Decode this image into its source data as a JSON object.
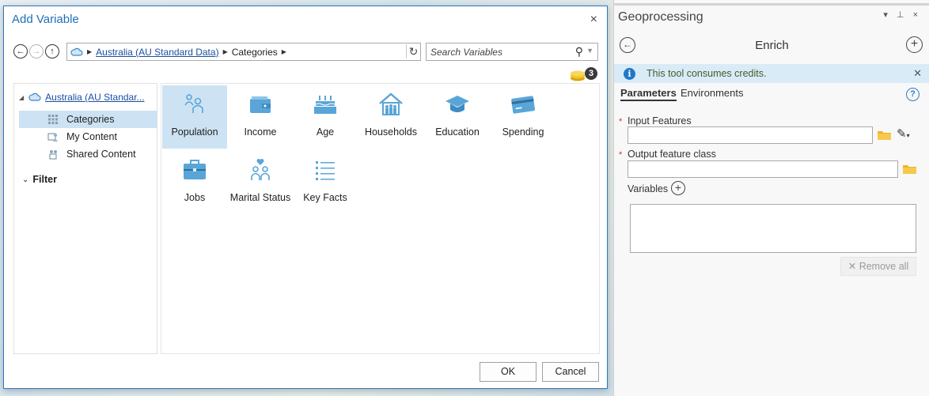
{
  "dialog": {
    "title": "Add Variable",
    "close": "×",
    "path": {
      "root_link": "Australia (AU Standard Data)",
      "segment": "Categories"
    },
    "search": {
      "placeholder": "Search Variables"
    },
    "credits_count": "3",
    "tree": {
      "root_label": "Australia (AU Standar...",
      "items": [
        {
          "label": "Categories",
          "icon": "grid-icon",
          "selected": true
        },
        {
          "label": "My Content",
          "icon": "user-content-icon"
        },
        {
          "label": "Shared Content",
          "icon": "shared-content-icon"
        }
      ],
      "filter_label": "Filter"
    },
    "categories": [
      {
        "label": "Population",
        "icon": "population-icon",
        "selected": true
      },
      {
        "label": "Income",
        "icon": "wallet-icon"
      },
      {
        "label": "Age",
        "icon": "birthday-cake-icon"
      },
      {
        "label": "Households",
        "icon": "house-icon"
      },
      {
        "label": "Education",
        "icon": "graduation-cap-icon"
      },
      {
        "label": "Spending",
        "icon": "credit-card-icon"
      },
      {
        "label": "Jobs",
        "icon": "briefcase-icon"
      },
      {
        "label": "Marital Status",
        "icon": "couple-heart-icon"
      },
      {
        "label": "Key Facts",
        "icon": "list-icon"
      }
    ],
    "ok_label": "OK",
    "cancel_label": "Cancel"
  },
  "pane": {
    "title": "Geoprocessing",
    "controls": "▾ ⊥ ×",
    "tool_name": "Enrich",
    "info_text": "This tool consumes credits.",
    "tabs": [
      "Parameters",
      "Environments"
    ],
    "params": {
      "input_features_label": "Input Features",
      "output_feature_class_label": "Output feature class",
      "variables_label": "Variables",
      "required_marker": "*"
    },
    "remove_all_label": "✕ Remove all"
  },
  "colors": {
    "accent": "#1f6fb8",
    "selection": "#cde3f3",
    "info_bar": "#d8ebf7",
    "icon_blue": "#5aa5d8",
    "folder": "#f0b429"
  }
}
